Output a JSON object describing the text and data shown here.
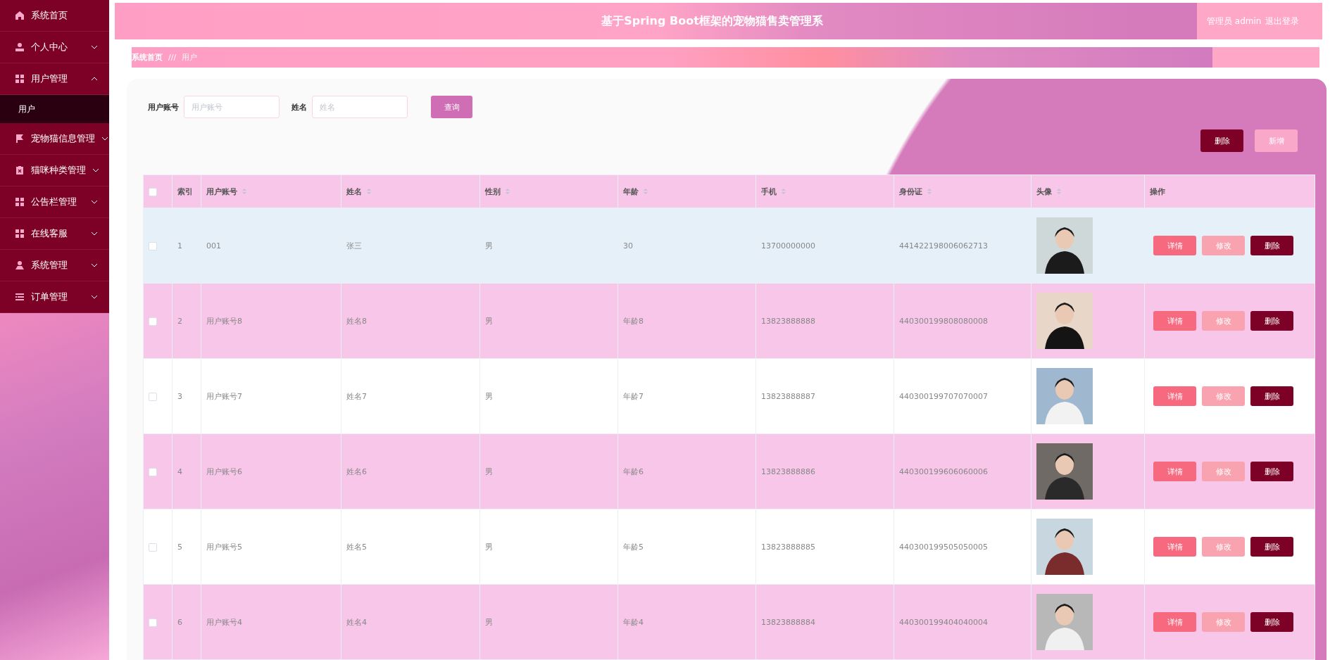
{
  "sidebar": {
    "items": [
      {
        "label": "系统首页"
      },
      {
        "label": "个人中心",
        "expanded": false
      },
      {
        "label": "用户管理",
        "expanded": true,
        "children": [
          {
            "label": "用户",
            "selected": true
          }
        ]
      },
      {
        "label": "宠物猫信息管理",
        "expanded": false
      },
      {
        "label": "猫咪种类管理",
        "expanded": false
      },
      {
        "label": "公告栏管理",
        "expanded": false
      },
      {
        "label": "在线客服",
        "expanded": false
      },
      {
        "label": "系统管理",
        "expanded": false
      },
      {
        "label": "订单管理",
        "expanded": false
      }
    ]
  },
  "header": {
    "title": "基于Spring Boot框架的宠物猫售卖管理系",
    "user": "管理员 admin",
    "logout": "退出登录"
  },
  "breadcrumb": {
    "home": "系统首页",
    "separator": "///",
    "current": "用户"
  },
  "search": {
    "fields": [
      {
        "label": "用户账号",
        "placeholder": "用户账号"
      },
      {
        "label": "姓名",
        "placeholder": "姓名"
      }
    ],
    "button": "查询"
  },
  "actions": [
    {
      "label": "删除",
      "kind": "danger"
    },
    {
      "label": "新增",
      "kind": "add"
    }
  ],
  "table": {
    "select_all": {
      "checked": false
    },
    "columns": [
      {
        "label": "索引"
      },
      {
        "label": "用户账号",
        "sortable": true
      },
      {
        "label": "姓名",
        "sortable": true
      },
      {
        "label": "性别",
        "sortable": true
      },
      {
        "label": "年龄",
        "sortable": true
      },
      {
        "label": "手机",
        "sortable": true
      },
      {
        "label": "身份证",
        "sortable": true
      },
      {
        "label": "头像",
        "sortable": true
      },
      {
        "label": "操作"
      }
    ],
    "rows": [
      {
        "checked": false,
        "highlighted": true,
        "cells": [
          "1",
          "001",
          "张三",
          "男",
          "30",
          "13700000000",
          "441422198006062713"
        ],
        "buttons": [
          {
            "label": "详情",
            "kind": "detail"
          },
          {
            "label": "修改",
            "kind": "edit"
          },
          {
            "label": "删除",
            "kind": "delete"
          }
        ]
      },
      {
        "checked": false,
        "highlighted": false,
        "cells": [
          "2",
          "用户账号8",
          "姓名8",
          "男",
          "年龄8",
          "13823888888",
          "440300199808080008"
        ],
        "buttons": [
          {
            "label": "详情",
            "kind": "detail"
          },
          {
            "label": "修改",
            "kind": "edit"
          },
          {
            "label": "删除",
            "kind": "delete"
          }
        ]
      },
      {
        "checked": false,
        "highlighted": false,
        "cells": [
          "3",
          "用户账号7",
          "姓名7",
          "男",
          "年龄7",
          "13823888887",
          "440300199707070007"
        ],
        "buttons": [
          {
            "label": "详情",
            "kind": "detail"
          },
          {
            "label": "修改",
            "kind": "edit"
          },
          {
            "label": "删除",
            "kind": "delete"
          }
        ]
      },
      {
        "checked": false,
        "highlighted": false,
        "cells": [
          "4",
          "用户账号6",
          "姓名6",
          "男",
          "年龄6",
          "13823888886",
          "440300199606060006"
        ],
        "buttons": [
          {
            "label": "详情",
            "kind": "detail"
          },
          {
            "label": "修改",
            "kind": "edit"
          },
          {
            "label": "删除",
            "kind": "delete"
          }
        ]
      },
      {
        "checked": false,
        "highlighted": false,
        "cells": [
          "5",
          "用户账号5",
          "姓名5",
          "男",
          "年龄5",
          "13823888885",
          "440300199505050005"
        ],
        "buttons": [
          {
            "label": "详情",
            "kind": "detail"
          },
          {
            "label": "修改",
            "kind": "edit"
          },
          {
            "label": "删除",
            "kind": "delete"
          }
        ]
      },
      {
        "checked": false,
        "highlighted": false,
        "cells": [
          "6",
          "用户账号4",
          "姓名4",
          "男",
          "年龄4",
          "13823888884",
          "440300199404040004"
        ],
        "buttons": [
          {
            "label": "详情",
            "kind": "detail"
          },
          {
            "label": "修改",
            "kind": "edit"
          },
          {
            "label": "删除",
            "kind": "delete"
          }
        ]
      }
    ]
  }
}
